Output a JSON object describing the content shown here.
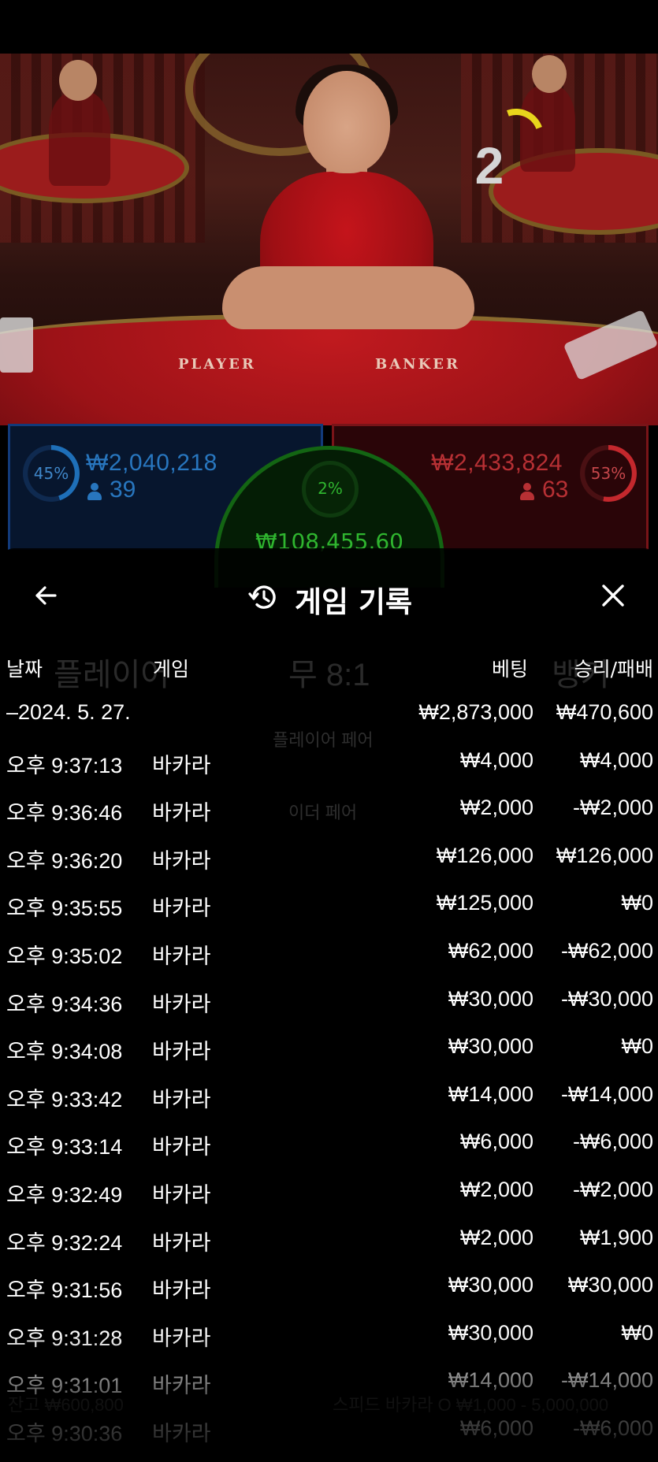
{
  "stream": {
    "round_number": "2",
    "table_left_label": "PLAYER",
    "table_right_label": "BANKER"
  },
  "bets": {
    "player": {
      "percent": "45%",
      "percent_value": 0.45,
      "amount": "₩2,040,218",
      "players": "39",
      "color": "#1e6fb8"
    },
    "banker": {
      "percent": "53%",
      "percent_value": 0.53,
      "amount": "₩2,433,824",
      "players": "63",
      "color": "#c4282d"
    },
    "tie": {
      "percent": "2%",
      "amount": "₩108,455.60",
      "color": "#2fb52f"
    }
  },
  "background_board": {
    "player_label": "플레이어",
    "tie_label": "무 8:1",
    "banker_label": "뱅커",
    "player_pair": "플레이어 페어",
    "either_pair": "이더 페어",
    "balance": "잔고 ₩600,800",
    "game_name": "스피드 바카라 O ₩1,000 - 5,000,000"
  },
  "history": {
    "title": "게임 기록",
    "back_icon": "arrow-left-icon",
    "history_icon": "clock-history-icon",
    "close_icon": "close-icon",
    "columns": {
      "date": "날짜",
      "game": "게임",
      "bet": "베팅",
      "result": "승리/패배"
    },
    "day": {
      "date": "–2024. 5. 27.",
      "bet": "₩2,873,000",
      "result": "₩470,600"
    },
    "rows": [
      {
        "time": "오후 9:37:13",
        "game": "바카라",
        "bet": "₩4,000",
        "result": "₩4,000"
      },
      {
        "time": "오후 9:36:46",
        "game": "바카라",
        "bet": "₩2,000",
        "result": "-₩2,000"
      },
      {
        "time": "오후 9:36:20",
        "game": "바카라",
        "bet": "₩126,000",
        "result": "₩126,000"
      },
      {
        "time": "오후 9:35:55",
        "game": "바카라",
        "bet": "₩125,000",
        "result": "₩0"
      },
      {
        "time": "오후 9:35:02",
        "game": "바카라",
        "bet": "₩62,000",
        "result": "-₩62,000"
      },
      {
        "time": "오후 9:34:36",
        "game": "바카라",
        "bet": "₩30,000",
        "result": "-₩30,000"
      },
      {
        "time": "오후 9:34:08",
        "game": "바카라",
        "bet": "₩30,000",
        "result": "₩0"
      },
      {
        "time": "오후 9:33:42",
        "game": "바카라",
        "bet": "₩14,000",
        "result": "-₩14,000"
      },
      {
        "time": "오후 9:33:14",
        "game": "바카라",
        "bet": "₩6,000",
        "result": "-₩6,000"
      },
      {
        "time": "오후 9:32:49",
        "game": "바카라",
        "bet": "₩2,000",
        "result": "-₩2,000"
      },
      {
        "time": "오후 9:32:24",
        "game": "바카라",
        "bet": "₩2,000",
        "result": "₩1,900"
      },
      {
        "time": "오후 9:31:56",
        "game": "바카라",
        "bet": "₩30,000",
        "result": "₩30,000"
      },
      {
        "time": "오후 9:31:28",
        "game": "바카라",
        "bet": "₩30,000",
        "result": "₩0"
      },
      {
        "time": "오후 9:31:01",
        "game": "바카라",
        "bet": "₩14,000",
        "result": "-₩14,000"
      },
      {
        "time": "오후 9:30:36",
        "game": "바카라",
        "bet": "₩6,000",
        "result": "-₩6,000"
      }
    ]
  }
}
